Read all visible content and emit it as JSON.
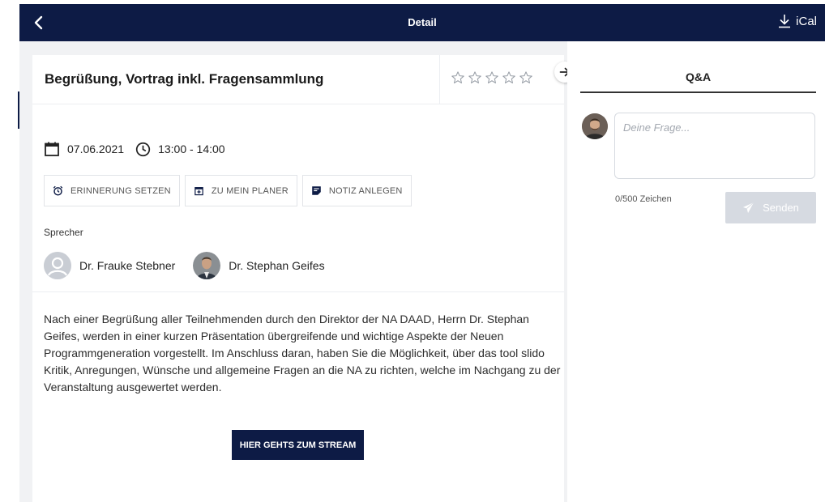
{
  "header": {
    "title": "Detail",
    "ical_label": "iCal",
    "back_icon": "chevron-left-icon",
    "ical_icon": "download-icon",
    "background": "#0d1b45"
  },
  "session": {
    "title": "Begrüßung, Vortrag inkl. Fragensammlung",
    "rating": 0,
    "rating_max": 5,
    "date": "07.06.2021",
    "time": "13:00 - 14:00",
    "actions": [
      {
        "label": "ERINNERUNG SETZEN",
        "icon": "alarm-clock-icon"
      },
      {
        "label": "ZU MEIN PLANER",
        "icon": "calendar-add-icon"
      },
      {
        "label": "NOTIZ ANLEGEN",
        "icon": "note-icon"
      }
    ],
    "speakers_label": "Sprecher",
    "speakers": [
      {
        "name": "Dr. Frauke Stebner",
        "avatar": "placeholder"
      },
      {
        "name": "Dr. Stephan Geifes",
        "avatar": "photo"
      }
    ],
    "description": "Nach einer Begrüßung aller Teilnehmenden durch den Direktor der NA DAAD, Herrn Dr. Stephan Geifes, werden in einer kurzen Präsentation übergreifende und wichtige Aspekte der Neuen Programmgeneration vorgestellt. Im Anschluss daran, haben Sie die Möglichkeit, über das tool slido Kritik, Anregungen, Wünsche und allgemeine Fragen an die NA zu richten, welche im Nachgang zu der Veranstaltung ausgewertet werden.",
    "stream_button": "HIER GEHTS ZUM STREAM"
  },
  "qa": {
    "tab_label": "Q&A",
    "input_value": "",
    "input_placeholder": "Deine Frage...",
    "char_count": "0/500 Zeichen",
    "send_label": "Senden",
    "send_icon": "paper-plane-icon"
  }
}
